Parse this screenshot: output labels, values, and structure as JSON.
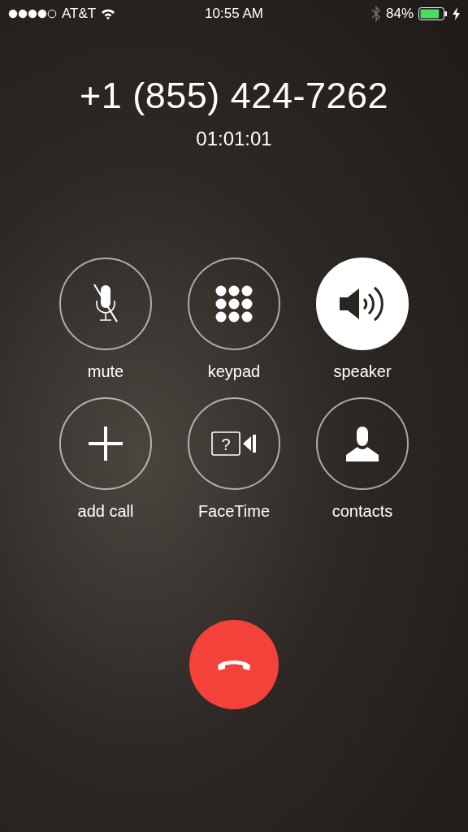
{
  "status_bar": {
    "carrier": "AT&T",
    "time": "10:55 AM",
    "battery_percent": "84%",
    "charging": true,
    "bluetooth_on": false
  },
  "call": {
    "number": "+1 (855) 424-7262",
    "duration": "01:01:01"
  },
  "buttons": [
    {
      "kind": "mute",
      "label": "mute",
      "on": false
    },
    {
      "kind": "keypad",
      "label": "keypad",
      "on": false
    },
    {
      "kind": "speaker",
      "label": "speaker",
      "on": true
    },
    {
      "kind": "add",
      "label": "add call",
      "on": false
    },
    {
      "kind": "facetime",
      "label": "FaceTime",
      "on": false,
      "glyph": "?"
    },
    {
      "kind": "contacts",
      "label": "contacts",
      "on": false
    }
  ]
}
